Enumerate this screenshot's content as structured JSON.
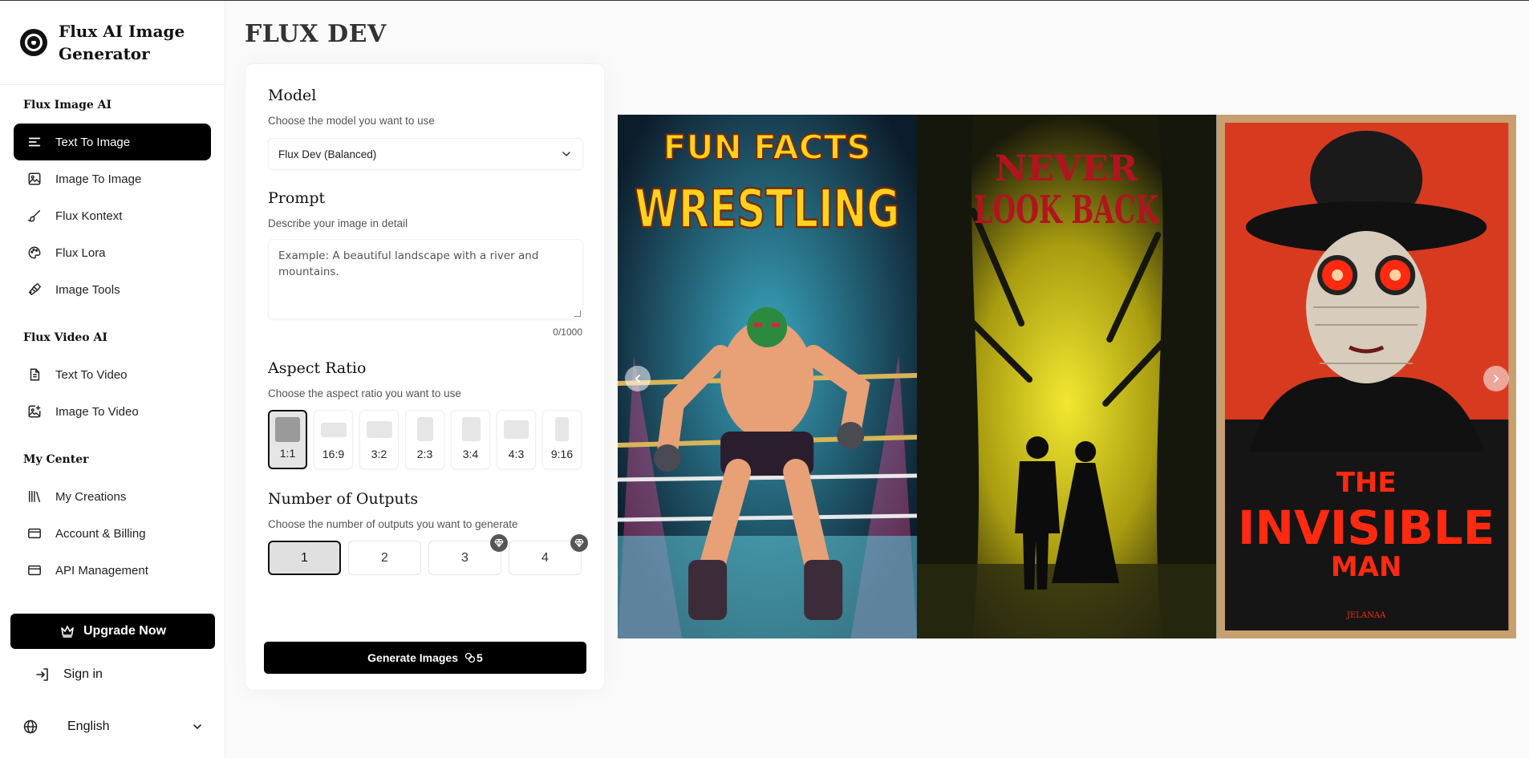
{
  "brand": {
    "title": "Flux AI Image Generator"
  },
  "sidebar": {
    "section_image": "Flux Image AI",
    "image_items": [
      {
        "label": "Text To Image",
        "icon": "lines-icon",
        "active": true
      },
      {
        "label": "Image To Image",
        "icon": "image-icon"
      },
      {
        "label": "Flux Kontext",
        "icon": "brush-icon"
      },
      {
        "label": "Flux Lora",
        "icon": "palette-icon"
      },
      {
        "label": "Image Tools",
        "icon": "paintbrush-icon"
      }
    ],
    "section_video": "Flux Video AI",
    "video_items": [
      {
        "label": "Text To Video",
        "icon": "document-icon"
      },
      {
        "label": "Image To Video",
        "icon": "image-plus-icon"
      }
    ],
    "section_center": "My Center",
    "center_items": [
      {
        "label": "My Creations",
        "icon": "library-icon"
      },
      {
        "label": "Account & Billing",
        "icon": "card-icon"
      },
      {
        "label": "API Management",
        "icon": "card-icon"
      }
    ],
    "upgrade_label": "Upgrade Now",
    "signin_label": "Sign in",
    "language": "English"
  },
  "page": {
    "title": "FLUX DEV"
  },
  "form": {
    "model": {
      "title": "Model",
      "desc": "Choose the model you want to use",
      "value": "Flux Dev (Balanced)"
    },
    "prompt": {
      "title": "Prompt",
      "desc": "Describe your image in detail",
      "placeholder": "Example: A beautiful landscape with a river and mountains.",
      "counter": "0/1000"
    },
    "aspect": {
      "title": "Aspect Ratio",
      "desc": "Choose the aspect ratio you want to use",
      "options": [
        "1:1",
        "16:9",
        "3:2",
        "2:3",
        "3:4",
        "4:3",
        "9:16"
      ],
      "selected": "1:1"
    },
    "outputs": {
      "title": "Number of Outputs",
      "desc": "Choose the number of outputs you want to generate",
      "options": [
        "1",
        "2",
        "3",
        "4"
      ],
      "selected": "1",
      "premium": [
        "3",
        "4"
      ]
    },
    "generate": {
      "label": "Generate Images",
      "cost": "5"
    }
  },
  "carousel": {
    "posters": [
      {
        "line1": "FUN FACTS",
        "line2": "WRESTLING"
      },
      {
        "line1": "NEVER",
        "line2": "LOOK BACK"
      },
      {
        "line1": "THE",
        "line2": "INVISIBLE",
        "line3": "MAN",
        "footer": "JELANAA"
      }
    ]
  },
  "colors": {
    "accent": "#000000",
    "poster1_bg": "#1c4e5e",
    "poster1_text": "#ffd21f",
    "poster2_bg": "#d8c81a",
    "poster2_text": "#b3131f",
    "poster3_bg": "#d83a20",
    "poster3_text": "#ff2a10"
  }
}
